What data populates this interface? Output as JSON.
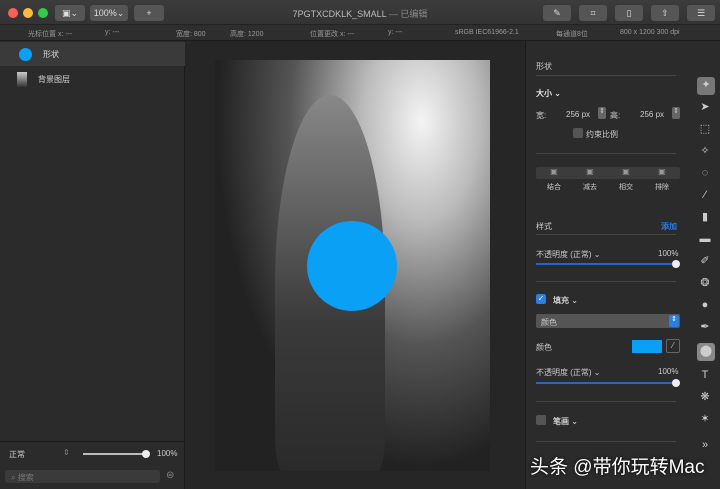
{
  "window": {
    "title": "7PGTXCDKLK_SMALL",
    "edited": "— 已编辑",
    "zoom": "100%",
    "add": "+"
  },
  "info": {
    "cursor_x": "光标位置 x: ---",
    "cursor_y": "y: ---",
    "width": "宽度: 800",
    "height": "高度: 1200",
    "change_x": "位置更改 x: ---",
    "change_y": "y: ---",
    "profile": "sRGB IEC61966-2.1",
    "depth": "每通道8位",
    "size": "800 x 1200 300 dpi"
  },
  "layers": [
    {
      "name": "形状"
    },
    {
      "name": "背景图层"
    }
  ],
  "left_footer": {
    "blend": "正常",
    "opacity": "100%",
    "search_placeholder": "搜索"
  },
  "panel": {
    "title": "形状",
    "size_label": "大小",
    "width_label": "宽:",
    "width_value": "256 px",
    "height_label": "高:",
    "height_value": "256 px",
    "constrain": "约束比例",
    "ops": [
      "结合",
      "减去",
      "相交",
      "排除"
    ],
    "style_label": "样式",
    "add": "添加",
    "opacity_label": "不透明度 (正常)",
    "opacity_value": "100%",
    "fill_label": "填充",
    "fill_type": "颜色",
    "color_label": "颜色",
    "fill_color": "#0aa0f5",
    "fill_opacity_label": "不透明度 (正常)",
    "fill_opacity_value": "100%",
    "stroke_label": "笔画"
  },
  "watermark": "头条 @带你玩转Mac"
}
